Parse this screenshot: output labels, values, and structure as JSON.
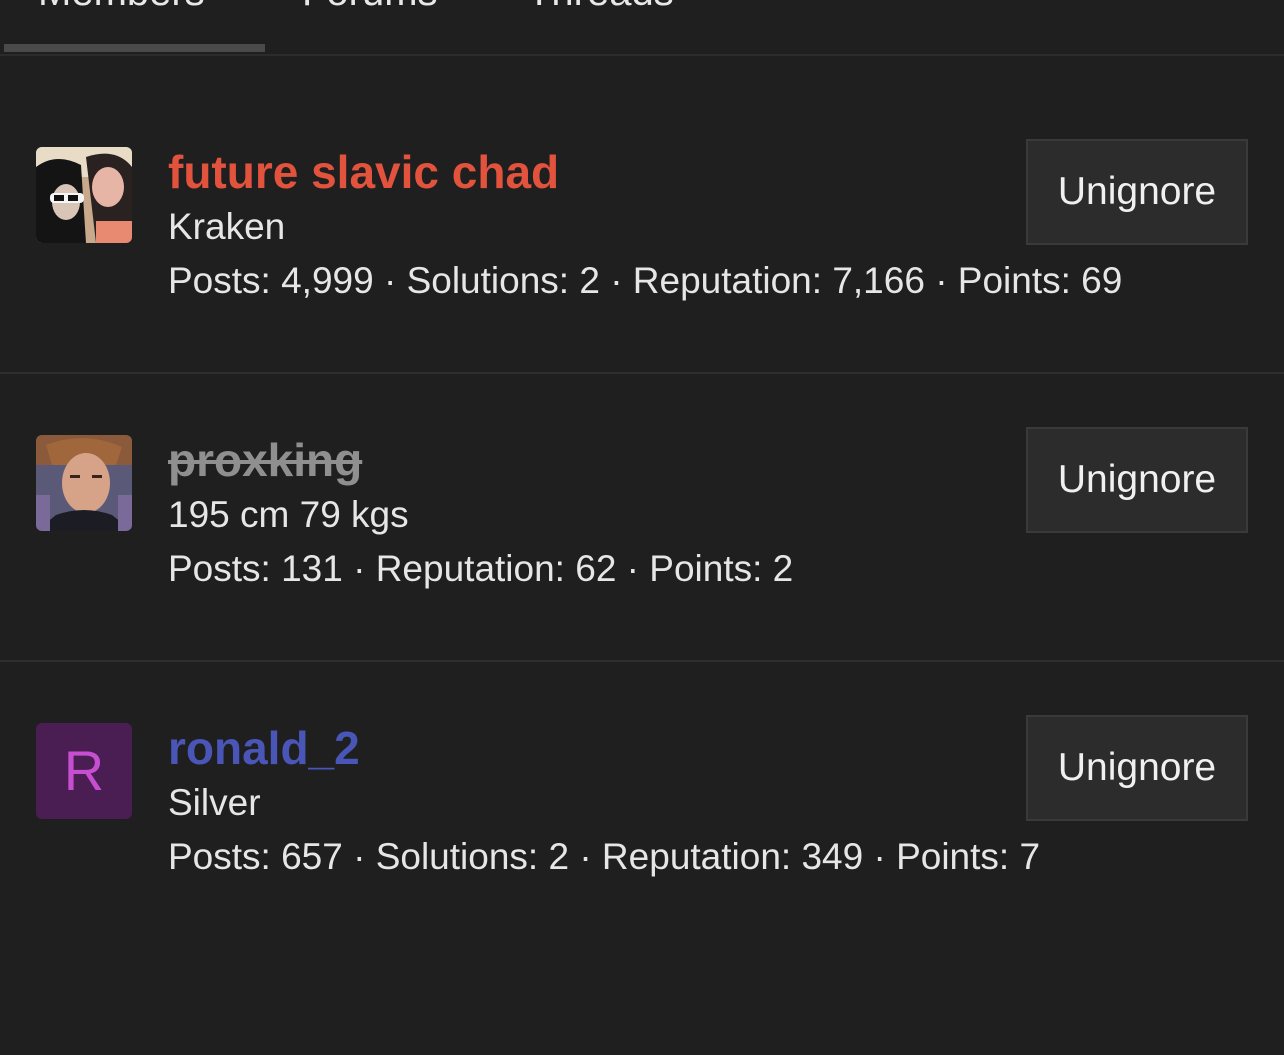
{
  "tabs": [
    {
      "label": "Members"
    },
    {
      "label": "Forums"
    },
    {
      "label": "Threads"
    }
  ],
  "active_tab": "Members",
  "members": [
    {
      "username": "future slavic chad",
      "username_color": "#e2533e",
      "strikethrough": false,
      "title": "Kraken",
      "stats": "Posts: 4,999 · Solutions: 2 · Reputation: 7,166 · Points: 69",
      "avatar": "photo",
      "button_label": "Unignore"
    },
    {
      "username": "proxking",
      "username_color": "#8f8f8f",
      "strikethrough": true,
      "title": "195 cm 79 kgs",
      "stats": "Posts: 131 · Reputation: 62 · Points: 2",
      "avatar": "photo",
      "button_label": "Unignore"
    },
    {
      "username": "ronald_2",
      "username_color": "#4a55b8",
      "strikethrough": false,
      "title": "Silver",
      "stats": "Posts: 657 · Solutions: 2 · Reputation: 349 · Points: 7",
      "avatar_letter": "R",
      "avatar_bg": "#4a1d53",
      "button_label": "Unignore"
    }
  ],
  "colors": {
    "background": "#1f1f1f",
    "button_bg": "#2c2c2c",
    "divider": "#2e2e2e"
  }
}
